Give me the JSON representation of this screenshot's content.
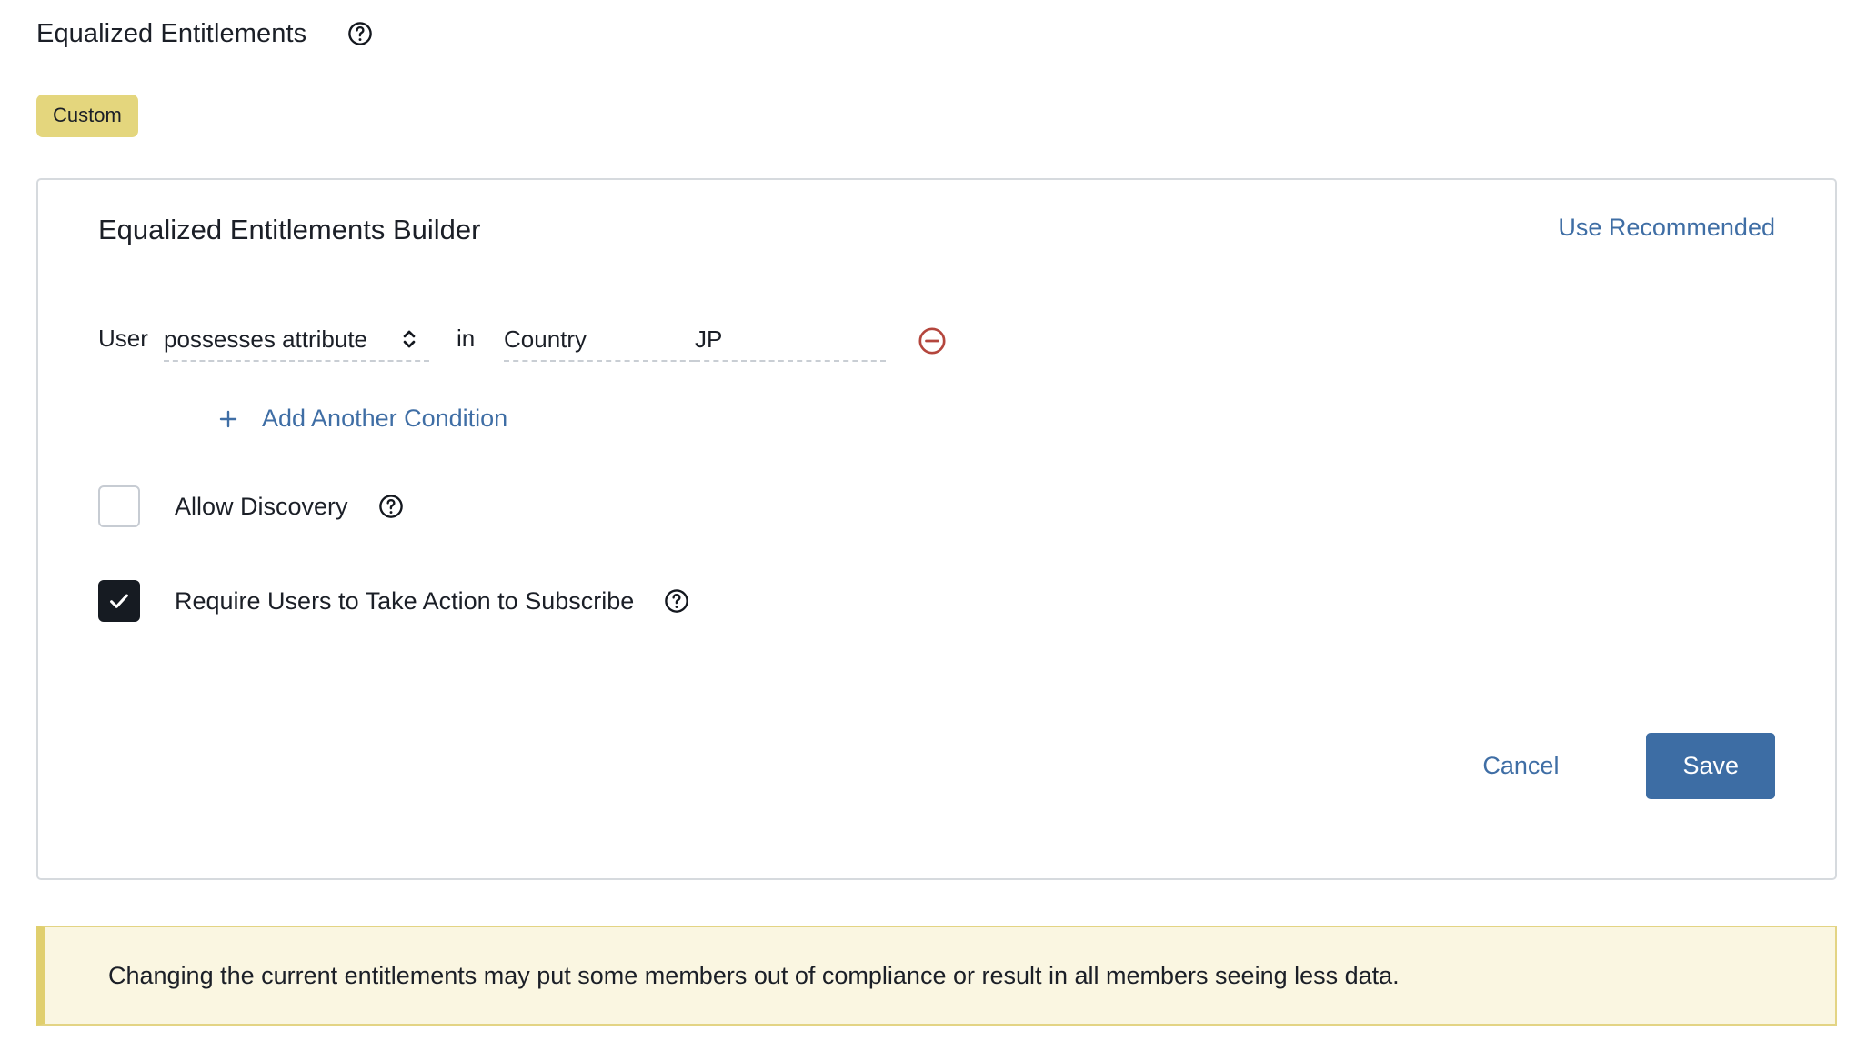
{
  "header": {
    "title": "Equalized Entitlements",
    "help_icon": "help-circle-icon",
    "badge": "Custom"
  },
  "card": {
    "title": "Equalized Entitlements Builder",
    "use_recommended": "Use Recommended",
    "condition": {
      "subject": "User",
      "predicate": "possesses attribute",
      "stepper_icon": "chevron-up-down-icon",
      "joiner": "in",
      "attribute": "Country",
      "value": "JP",
      "remove_icon": "minus-circle-icon"
    },
    "add_condition": {
      "icon": "plus-icon",
      "label": "Add Another Condition"
    },
    "options": [
      {
        "label": "Allow Discovery",
        "checked": false,
        "help_icon": "help-circle-icon"
      },
      {
        "label": "Require Users to Take Action to Subscribe",
        "checked": true,
        "help_icon": "help-circle-icon"
      }
    ],
    "actions": {
      "cancel": "Cancel",
      "save": "Save"
    }
  },
  "banner": {
    "message": "Changing the current entitlements may put some members out of compliance or result in all members seeing less data."
  },
  "colors": {
    "link": "#3f6ea5",
    "save_button": "#3d6da4",
    "badge": "#e4d67d",
    "remove": "#b4463d",
    "banner_bg": "#faf6e1",
    "banner_border": "#e3d484",
    "checked_box": "#161b22"
  }
}
